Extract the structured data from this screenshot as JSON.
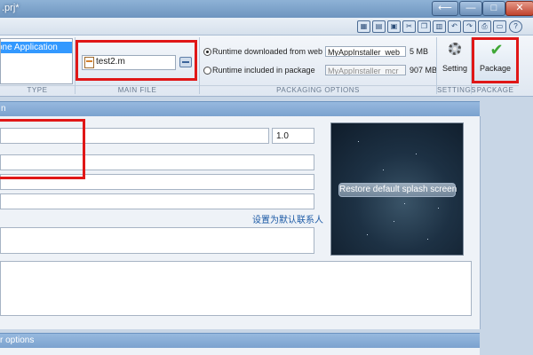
{
  "window": {
    "title": ".prj*",
    "buttons": {
      "back": "⟵",
      "minimize": "—",
      "maximize": "□",
      "close": "✕"
    }
  },
  "quick_toolbar": {
    "icons": [
      "map-icon",
      "document-icon",
      "save-icon",
      "cut-icon",
      "copy-icon",
      "paste-icon",
      "undo-icon",
      "redo-icon",
      "print-icon",
      "help-icon"
    ]
  },
  "ribbon": {
    "type": {
      "label": "TYPE",
      "selected_item": "one Application"
    },
    "main_file": {
      "label": "MAIN FILE",
      "file_name": "test2.m"
    },
    "packaging_options": {
      "label": "PACKAGING OPTIONS",
      "options": [
        {
          "label": "Runtime downloaded from web",
          "field_value": "MyAppInstaller_web",
          "size": "5 MB",
          "selected": true
        },
        {
          "label": "Runtime included in package",
          "field_value": "MyAppInstaller_mcr",
          "size": "907 MB",
          "selected": false
        }
      ]
    },
    "settings": {
      "label": "SETTINGS",
      "button_label": "Setting"
    },
    "package": {
      "label": "PACKAGE",
      "button_label": "Package"
    }
  },
  "app_info": {
    "header": "n",
    "version": "1.0",
    "set_default_contact_link": "设置为默认联系人",
    "splash": {
      "restore_button": "Restore default splash screen"
    }
  },
  "additional_options": {
    "header": "r options"
  },
  "colors": {
    "accent": "#3399ff",
    "highlight_box": "#e01717",
    "header": "#7ba2cf"
  }
}
